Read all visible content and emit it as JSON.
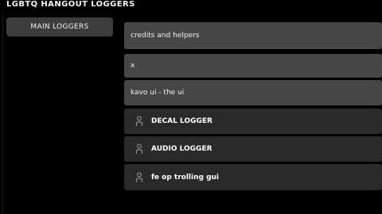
{
  "window": {
    "title": "LGBTQ HANGOUT LOGGERS"
  },
  "sidebar": {
    "tabs": [
      {
        "label": "MAIN LOGGERS"
      }
    ]
  },
  "list": {
    "items": [
      {
        "label": "credits and helpers"
      },
      {
        "label": "x"
      },
      {
        "label": "kavo ui - the ui"
      },
      {
        "label": "DECAL LOGGER",
        "icon": "script-icon"
      },
      {
        "label": "AUDIO LOGGER",
        "icon": "script-icon"
      },
      {
        "label": "fe op trolling gui",
        "icon": "script-icon"
      }
    ]
  },
  "colors": {
    "background": "#000000",
    "tab": "#3d3d3d",
    "label_row": "#464646",
    "script_row": "#2a2a2a",
    "icon": "#8a8a8a"
  }
}
